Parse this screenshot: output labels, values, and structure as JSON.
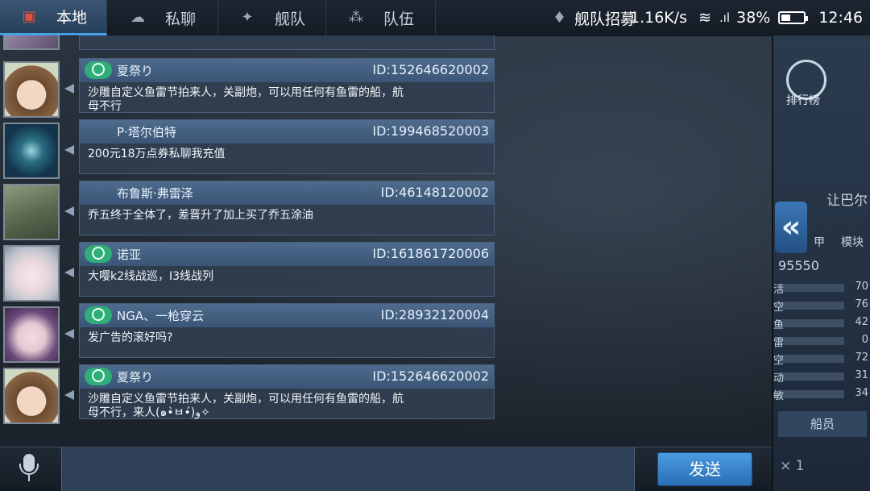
{
  "top_bar": {
    "tabs": [
      {
        "label": "本地",
        "icon": "local-chat-icon",
        "active": true
      },
      {
        "label": "私聊",
        "icon": "private-chat-icon",
        "active": false
      },
      {
        "label": "舰队",
        "icon": "fleet-icon",
        "active": false
      },
      {
        "label": "队伍",
        "icon": "team-icon",
        "active": false
      }
    ],
    "recruit_label": "舰队招募",
    "net_speed": "1.16K/s",
    "battery_pct": "38%",
    "time": "12:46"
  },
  "messages": [
    {
      "name": "夏祭り",
      "id": "ID:152646620002",
      "badge": true,
      "line1": "沙雕自定义鱼雷节拍来人，关副炮，可以用任何有鱼雷的船，航",
      "line2": "母不行",
      "avatar": "avatar-anime-girl-brown-hair"
    },
    {
      "name": "P·塔尔伯特",
      "id": "ID:199468520003",
      "badge": false,
      "line1": "200元18万点券私聊我充值",
      "line2": "",
      "avatar": "avatar-compass-emblem"
    },
    {
      "name": "布鲁斯·弗雷泽",
      "id": "ID:46148120002",
      "badge": false,
      "line1": "乔五终于全体了，差晋升了加上买了乔五涂油",
      "line2": "",
      "avatar": "avatar-wolves"
    },
    {
      "name": "诺亚",
      "id": "ID:161861720006",
      "badge": true,
      "line1": "大嘤k2线战巡，I3线战列",
      "line2": "",
      "avatar": "avatar-anime-girl-white-hair"
    },
    {
      "name": "NGA、一枪穿云",
      "id": "ID:28932120004",
      "badge": true,
      "line1": "发广告的滚好吗?",
      "line2": "",
      "avatar": "avatar-anime-girl-purple-hair"
    },
    {
      "name": "夏祭り",
      "id": "ID:152646620002",
      "badge": true,
      "line1": "沙雕自定义鱼雷节拍来人，关副炮，可以用任何有鱼雷的船，航",
      "line2": "母不行，来人(๑•̀ㅂ•́)و✧",
      "avatar": "avatar-anime-girl-brown-hair"
    }
  ],
  "side_panel": {
    "rank_label": "排行榜",
    "name_fragment": "让巴尔",
    "score": "95550",
    "stats": [
      {
        "lab": "活",
        "val": "70"
      },
      {
        "lab": "空",
        "val": "76"
      },
      {
        "lab": "鱼",
        "val": "42"
      },
      {
        "lab": "雷",
        "val": "0"
      },
      {
        "lab": "空",
        "val": "72"
      },
      {
        "lab": "动",
        "val": "31"
      },
      {
        "lab": "敏",
        "val": "34"
      }
    ],
    "tab_labels": [
      "甲",
      "模块"
    ],
    "crew_label": "船员",
    "count_label": "× 1"
  },
  "input": {
    "send_label": "发送"
  },
  "colors": {
    "accent": "#4aa0e6",
    "badge": "#2fae7a",
    "send": "#3a86cf"
  }
}
